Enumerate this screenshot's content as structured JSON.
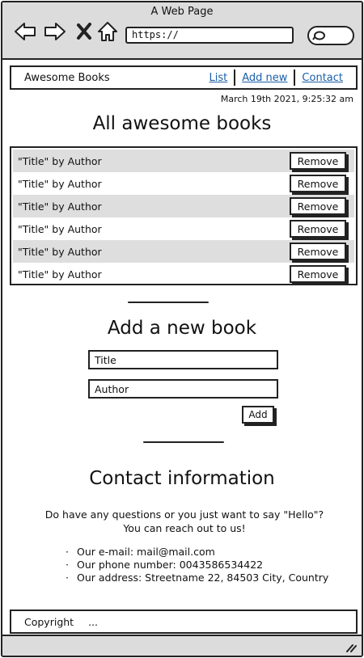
{
  "browser": {
    "window_title": "A Web Page",
    "url": "https://",
    "icons": [
      "back-arrow-icon",
      "forward-arrow-icon",
      "close-x-icon",
      "home-icon",
      "search-icon",
      "resize-grip-icon"
    ]
  },
  "header": {
    "brand": "Awesome Books",
    "nav": [
      {
        "label": "List"
      },
      {
        "label": "Add new"
      },
      {
        "label": "Contact"
      }
    ]
  },
  "timestamp": "March 19th 2021, 9:25:32 am",
  "list_section": {
    "heading": "All awesome books",
    "books": [
      {
        "text": "\"Title\" by Author",
        "button": "Remove"
      },
      {
        "text": "\"Title\" by Author",
        "button": "Remove"
      },
      {
        "text": "\"Title\" by Author",
        "button": "Remove"
      },
      {
        "text": "\"Title\" by Author",
        "button": "Remove"
      },
      {
        "text": "\"Title\" by Author",
        "button": "Remove"
      },
      {
        "text": "\"Title\" by Author",
        "button": "Remove"
      }
    ]
  },
  "add_section": {
    "heading": "Add a new book",
    "title_placeholder": "Title",
    "author_placeholder": "Author",
    "add_label": "Add"
  },
  "contact_section": {
    "heading": "Contact information",
    "intro_line1": "Do have any questions or you just want to say \"Hello\"?",
    "intro_line2": "You can reach out to us!",
    "items": [
      "Our e-mail: mail@mail.com",
      "Our phone number: 0043586534422",
      "Our address: Streetname 22, 84503 City, Country"
    ]
  },
  "footer": {
    "copyright": "Copyright",
    "ellipsis": "..."
  },
  "colors": {
    "link": "#1a5fa8",
    "chrome_bg": "#dcdcdc",
    "row_stripe": "#dedede"
  }
}
